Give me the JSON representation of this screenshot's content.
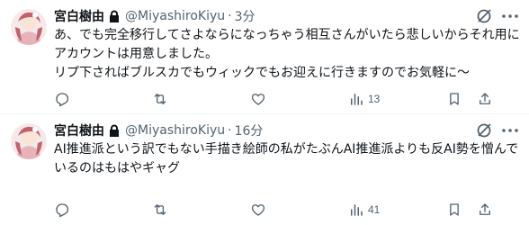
{
  "tweets": [
    {
      "name": "宮白樹由",
      "handle": "@MiyashiroKiyu",
      "separator": "·",
      "time": "3分",
      "text": "あ、でも完全移行してさよならになっちゃう相互さんがいたら悲しいからそれ用にアカウントは用意しました。\nリプ下さればブルスカでもウィックでもお迎えに行きますのでお気軽に〜",
      "views": "13"
    },
    {
      "name": "宮白樹由",
      "handle": "@MiyashiroKiyu",
      "separator": "·",
      "time": "16分",
      "text": "AI推進派という訳でもない手描き絵師の私がたぶんAI推進派よりも反AI勢を憎んでいるのはもはやギャグ",
      "views": "41"
    }
  ],
  "icons": {
    "lock": "lock-icon",
    "grok": "grok-icon",
    "more": "more-icon",
    "reply": "reply-icon",
    "retweet": "retweet-icon",
    "like": "like-icon",
    "views": "views-icon",
    "bookmark": "bookmark-icon",
    "share": "share-icon"
  },
  "colors": {
    "text": "#0f1419",
    "secondary": "#536471",
    "divider": "#eff3f4"
  }
}
